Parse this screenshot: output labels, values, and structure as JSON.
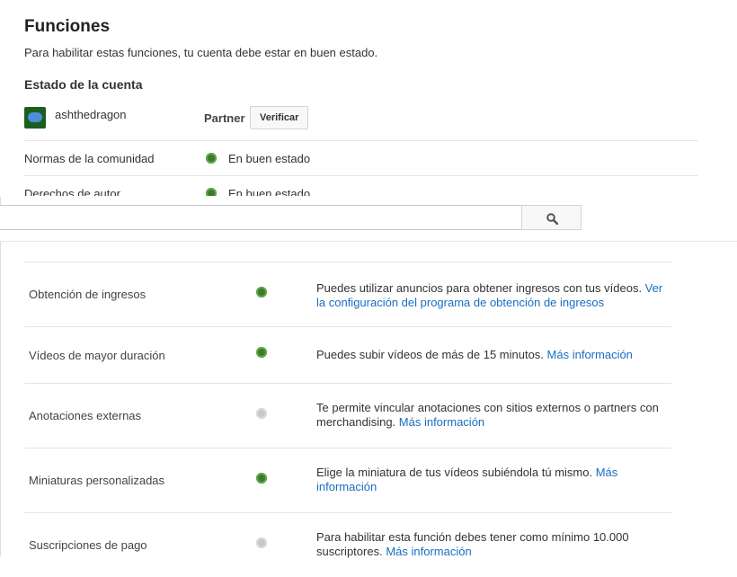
{
  "header": {
    "title": "Funciones",
    "subtitle": "Para habilitar estas funciones, tu cuenta debe estar en buen estado."
  },
  "account": {
    "section_title": "Estado de la cuenta",
    "username": "ashthedragon",
    "partner_label": "Partner",
    "verify_label": "Verificar",
    "rows": [
      {
        "label": "Normas de la comunidad",
        "status": "En buen estado"
      },
      {
        "label": "Derechos de autor",
        "status": "En buen estado"
      }
    ]
  },
  "search": {
    "value": "",
    "placeholder": ""
  },
  "features": [
    {
      "name": "Obtención de ingresos",
      "enabled": true,
      "desc": "Puedes utilizar anuncios para obtener ingresos con tus vídeos. ",
      "link": "Ver la configuración del programa de obtención de ingresos"
    },
    {
      "name": "Vídeos de mayor duración",
      "enabled": true,
      "desc": "Puedes subir vídeos de más de 15 minutos. ",
      "link": "Más información"
    },
    {
      "name": "Anotaciones externas",
      "enabled": false,
      "desc": "Te permite vincular anotaciones con sitios externos o partners con merchandising. ",
      "link": "Más información"
    },
    {
      "name": "Miniaturas personalizadas",
      "enabled": true,
      "desc": "Elige la miniatura de tus vídeos subiéndola tú mismo. ",
      "link": "Más información"
    },
    {
      "name": "Suscripciones de pago",
      "enabled": false,
      "desc": "Para habilitar esta función debes tener como mínimo 10.000 suscriptores. ",
      "link": "Más información"
    }
  ],
  "colors": {
    "enabled": "#3c7a2c",
    "disabled": "#c8c8c8",
    "link": "#1a6ec2"
  }
}
